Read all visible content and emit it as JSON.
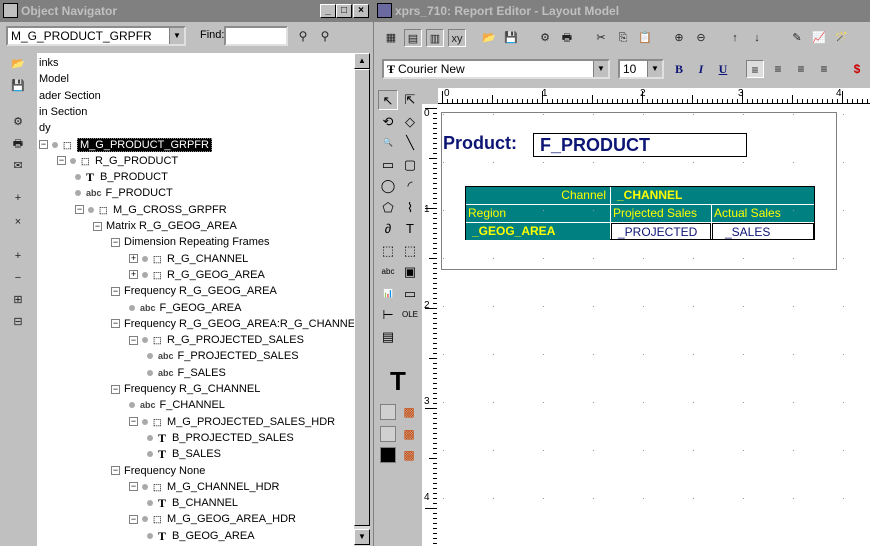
{
  "navigator": {
    "title": "Object Navigator",
    "object_combo": "M_G_PRODUCT_GRPFR",
    "find_label": "Find:",
    "find_value": "",
    "tree": [
      {
        "label": "inks",
        "indent": 0,
        "icon": "none",
        "expander": "none"
      },
      {
        "label": "Model",
        "indent": 0,
        "icon": "none",
        "expander": "none"
      },
      {
        "label": "ader Section",
        "indent": 0,
        "icon": "none",
        "expander": "none"
      },
      {
        "label": "in Section",
        "indent": 0,
        "icon": "none",
        "expander": "none"
      },
      {
        "label": "dy",
        "indent": 0,
        "icon": "none",
        "expander": "none"
      },
      {
        "label": "M_G_PRODUCT_GRPFR",
        "indent": 1,
        "icon": "frame",
        "expander": "minus",
        "selected": true
      },
      {
        "label": "R_G_PRODUCT",
        "indent": 2,
        "icon": "repframe",
        "expander": "minus"
      },
      {
        "label": "B_PRODUCT",
        "indent": 3,
        "icon": "text",
        "expander": "none"
      },
      {
        "label": "F_PRODUCT",
        "indent": 3,
        "icon": "field",
        "expander": "none"
      },
      {
        "label": "M_G_CROSS_GRPFR",
        "indent": 3,
        "icon": "frame",
        "expander": "minus"
      },
      {
        "label": "Matrix R_G_GEOG_AREA",
        "indent": 4,
        "icon": "none",
        "expander": "minus"
      },
      {
        "label": "Dimension Repeating Frames",
        "indent": 5,
        "icon": "none",
        "expander": "minus"
      },
      {
        "label": "R_G_CHANNEL",
        "indent": 6,
        "icon": "repframe",
        "expander": "plus"
      },
      {
        "label": "R_G_GEOG_AREA",
        "indent": 6,
        "icon": "repframe",
        "expander": "plus"
      },
      {
        "label": "Frequency R_G_GEOG_AREA",
        "indent": 5,
        "icon": "none",
        "expander": "minus"
      },
      {
        "label": "F_GEOG_AREA",
        "indent": 6,
        "icon": "field",
        "expander": "none"
      },
      {
        "label": "Frequency R_G_GEOG_AREA:R_G_CHANNEL",
        "indent": 5,
        "icon": "none",
        "expander": "minus"
      },
      {
        "label": "R_G_PROJECTED_SALES",
        "indent": 6,
        "icon": "repframe",
        "expander": "minus"
      },
      {
        "label": "F_PROJECTED_SALES",
        "indent": 7,
        "icon": "field",
        "expander": "none"
      },
      {
        "label": "F_SALES",
        "indent": 7,
        "icon": "field",
        "expander": "none"
      },
      {
        "label": "Frequency R_G_CHANNEL",
        "indent": 5,
        "icon": "none",
        "expander": "minus"
      },
      {
        "label": "F_CHANNEL",
        "indent": 6,
        "icon": "field",
        "expander": "none"
      },
      {
        "label": "M_G_PROJECTED_SALES_HDR",
        "indent": 6,
        "icon": "frame",
        "expander": "minus"
      },
      {
        "label": "B_PROJECTED_SALES",
        "indent": 7,
        "icon": "text",
        "expander": "none"
      },
      {
        "label": "B_SALES",
        "indent": 7,
        "icon": "text",
        "expander": "none"
      },
      {
        "label": "Frequency None",
        "indent": 5,
        "icon": "none",
        "expander": "minus"
      },
      {
        "label": "M_G_CHANNEL_HDR",
        "indent": 6,
        "icon": "frame",
        "expander": "minus"
      },
      {
        "label": "B_CHANNEL",
        "indent": 7,
        "icon": "text",
        "expander": "none"
      },
      {
        "label": "M_G_GEOG_AREA_HDR",
        "indent": 6,
        "icon": "frame",
        "expander": "minus"
      },
      {
        "label": "B_GEOG_AREA",
        "indent": 7,
        "icon": "text",
        "expander": "none"
      }
    ],
    "side_tools": [
      "open-folder-icon",
      "save-icon",
      "run-icon",
      "print-icon",
      "mail-icon",
      "create-icon",
      "delete-icon",
      "expand-icon",
      "collapse-icon",
      "expand-all-icon",
      "collapse-all-icon"
    ]
  },
  "editor": {
    "title": "xprs_710: Report Editor - Layout Model",
    "font_name": "Courier New",
    "font_size": "10",
    "bold": "B",
    "italic": "I",
    "underline": "U",
    "ruler_marks": [
      "0",
      "1",
      "2",
      "3",
      "4"
    ],
    "vruler_marks": [
      "0",
      "1",
      "2",
      "3",
      "4"
    ],
    "layout": {
      "product_label": "Product:",
      "product_field": "F_PRODUCT",
      "channel_label": "Channel",
      "channel_field": "_CHANNEL",
      "region_label": "Region",
      "projected_label": "Projected Sales",
      "actual_label": "Actual Sales",
      "geog_field": "_GEOG_AREA",
      "projected_field": "_PROJECTED",
      "sales_field": "_SALES"
    },
    "palette_big_t": "T",
    "colors": {
      "teal": "#008080",
      "yellow": "#ffff00",
      "navy": "#0d1575"
    }
  }
}
